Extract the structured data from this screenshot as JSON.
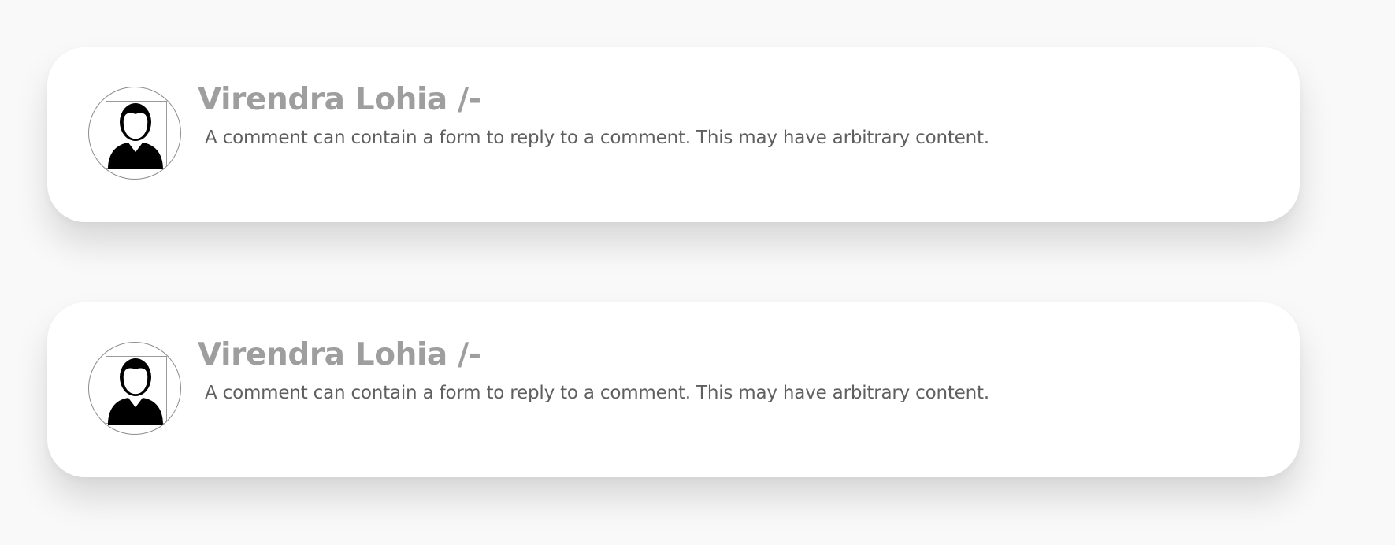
{
  "colors": {
    "background": "#f9f9f9",
    "card": "#ffffff",
    "author_name": "#9e9e9e",
    "comment_text": "#5f5f5f",
    "avatar_border": "#8c8c8c"
  },
  "comments": [
    {
      "avatar_icon": "user-silhouette-icon",
      "author": "Virendra Lohia /-",
      "text": "A comment can contain a form to reply to a comment. This may have arbitrary content."
    },
    {
      "avatar_icon": "user-silhouette-icon",
      "author": "Virendra Lohia /-",
      "text": "A comment can contain a form to reply to a comment. This may have arbitrary content."
    }
  ]
}
